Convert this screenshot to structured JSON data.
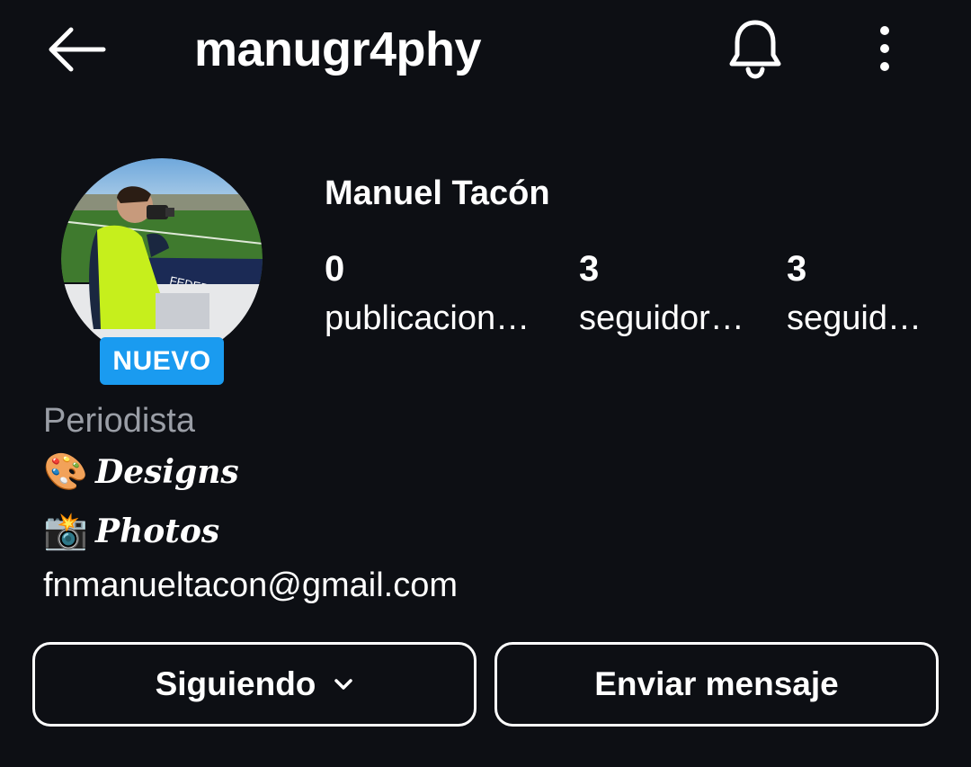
{
  "header": {
    "username": "manugr4phy",
    "icons": {
      "back": "arrow-left-icon",
      "bell": "bell-icon",
      "more": "more-vertical-icon"
    }
  },
  "profile": {
    "full_name": "Manuel Tacón",
    "badge": "NUEVO",
    "stats": [
      {
        "value": "0",
        "label": "publicacion…"
      },
      {
        "value": "3",
        "label": "seguidor…"
      },
      {
        "value": "3",
        "label": "seguid…"
      }
    ]
  },
  "bio": {
    "category": "Periodista",
    "lines": [
      {
        "emoji": "🎨",
        "text": "Designs"
      },
      {
        "emoji": "📸",
        "text": "Photos"
      }
    ],
    "email": "fnmanueltacon@gmail.com"
  },
  "actions": {
    "following_label": "Siguiendo",
    "message_label": "Enviar mensaje"
  },
  "colors": {
    "background": "#0d0f14",
    "badge": "#1a9bf0",
    "secondary_text": "#9a9ea6"
  }
}
